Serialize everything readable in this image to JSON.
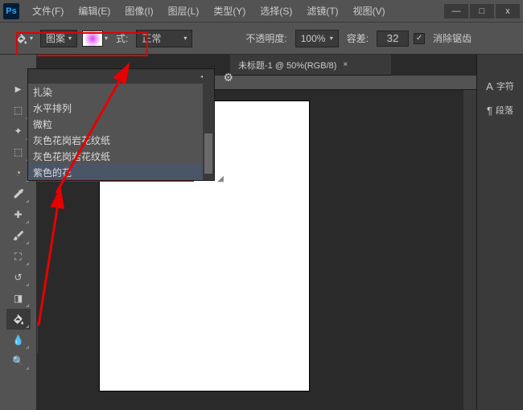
{
  "app": {
    "logo": "Ps"
  },
  "menu": [
    {
      "label": "文件(F)"
    },
    {
      "label": "编辑(E)"
    },
    {
      "label": "图像(I)"
    },
    {
      "label": "图层(L)"
    },
    {
      "label": "类型(Y)"
    },
    {
      "label": "选择(S)"
    },
    {
      "label": "滤镜(T)"
    },
    {
      "label": "视图(V)"
    }
  ],
  "win": {
    "min": "—",
    "max": "□",
    "close": "x"
  },
  "options": {
    "fill_type": "图案",
    "mode_label": "式:",
    "mode_value": "正常",
    "opacity_label": "不透明度:",
    "opacity_value": "100%",
    "tolerance_label": "容差:",
    "tolerance_value": "32",
    "antialias_label": "消除锯齿",
    "antialias_checked": "✓"
  },
  "document": {
    "tab_label": "未标题-1 @ 50%(RGB/8)",
    "close": "×"
  },
  "patterns": {
    "items": [
      "扎染",
      "水平排列",
      "微粒",
      "灰色花岗岩花纹纸",
      "灰色花岗岩花纹纸",
      "紫色的花"
    ],
    "selected_index": 5,
    "top_arrow": "◂ ▸"
  },
  "right_panel": [
    {
      "icon": "A",
      "label": "字符"
    },
    {
      "icon": "¶",
      "label": "段落"
    }
  ],
  "colors": {
    "annotation": "#e60000"
  }
}
